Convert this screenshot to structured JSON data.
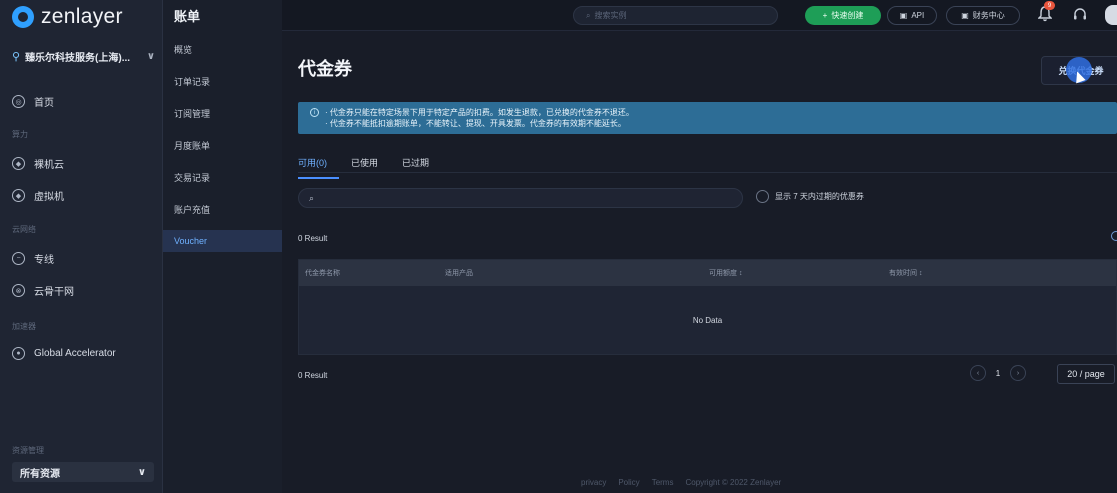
{
  "brand": {
    "name": "zenlayer"
  },
  "org": {
    "name": "臻乐尔科技服务(上海)..."
  },
  "sidebar": {
    "home": "首页",
    "sections": [
      {
        "label": "算力",
        "items": [
          "裸机云",
          "虚拟机"
        ]
      },
      {
        "label": "云网络",
        "items": [
          "专线",
          "云骨干网"
        ]
      },
      {
        "label": "加速器",
        "items": [
          "Global Accelerator"
        ]
      }
    ],
    "resource_label": "资源管理",
    "resource_select": "所有资源"
  },
  "subnav": {
    "title": "账单",
    "items": [
      "概览",
      "订单记录",
      "订阅管理",
      "月度账单",
      "交易记录",
      "账户充值",
      "Voucher"
    ],
    "active_index": 6
  },
  "topbar": {
    "search_placeholder": "搜索实例",
    "quick_create": "快速创建",
    "api": "API",
    "finance": "财务中心",
    "notification_count": "9"
  },
  "page": {
    "title": "代金券",
    "redeem_button": "兑换代金券",
    "notice": [
      "· 代金券只能在特定场景下用于特定产品的扣费。如发生退款，已兑换的代金券不退还。",
      "· 代金券不能抵扣逾期账单，不能转让、提现、开具发票。代金券的有效期不能延长。"
    ],
    "tabs": [
      "可用(0)",
      "已使用",
      "已过期"
    ],
    "active_tab": 0,
    "filter_checkbox": "显示 7 天内过期的优惠券",
    "result_top": "0 Result",
    "result_bottom": "0 Result",
    "columns": [
      "代金券名称",
      "适用产品",
      "可用额度 ↕",
      "有效时间 ↕"
    ],
    "empty_text": "No Data",
    "pagination": {
      "current": "1",
      "page_size": "20 / page"
    }
  },
  "footer": {
    "links": [
      "privacy",
      "Policy",
      "Terms",
      "Copyright © 2022 Zenlayer"
    ]
  },
  "colors": {
    "accent": "#4a8fff",
    "success": "#1e9e57",
    "notice_bg": "#2d6d96"
  }
}
